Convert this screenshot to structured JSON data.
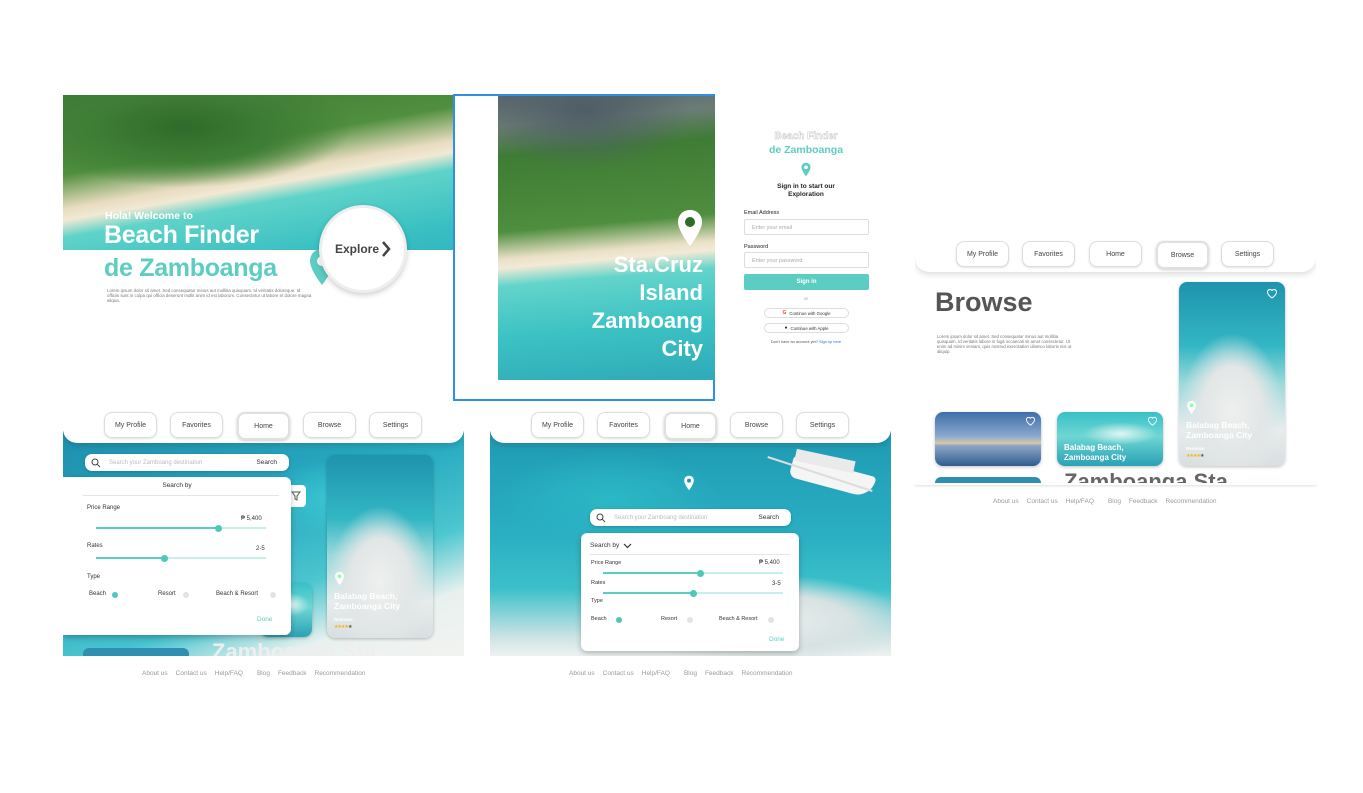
{
  "welcome": {
    "greeting": "Hola! Welcome to",
    "title_line1": "Beach Finder",
    "title_line2": "de Zamboanga",
    "explore": "Explore",
    "lorem": "Lorem ipsum dolor sit amet. Sed consequatur minus aut mollitia quisquam. Id veritatis doloreque. Id officiis sunt in culpa qui officia deserunt mollit anim id est laborum. Consectetur ut labore et dolore magna aliqua."
  },
  "splash": {
    "line1": "Sta.Cruz",
    "line2": "Island",
    "line3": "Zamboang",
    "line4": "City"
  },
  "signin": {
    "brand_line1": "Beach Finder",
    "brand_line2": "de Zamboanga",
    "heading": "Sign in to start our Exploration",
    "email_label": "Email Address",
    "email_placeholder": "Enter your email",
    "password_label": "Password",
    "password_placeholder": "Enter your password",
    "signin_button": "Sign in",
    "or": "or",
    "google": "Continue with Google",
    "apple": "Continue with Apple",
    "no_account": "Don't have an account yet?",
    "signup": "Sign up here"
  },
  "nav": {
    "my_profile": "My Profile",
    "favorites": "Favorites",
    "home": "Home",
    "browse": "Browse",
    "settings": "Settings"
  },
  "browse": {
    "title": "Browse",
    "lorem": "Lorem ipsum dolor sit amet. Sed consequatur minus aut mollitia quisquam. Id veritatis labore in fugit occaecati sit amet consectetur. Ut enim ad minim veniam, quis nostrud exercitation ullamco laboris nisi ut aliquip.",
    "feature_name": "Balabag Beach, Zamboanga City",
    "reviews": "Reviews:",
    "card2": "Balabag Beach, Zamboanga City",
    "bottom_title": "Zamboanga Sta"
  },
  "search": {
    "placeholder1": "Search your Zamboang destination",
    "placeholder2": "Search your Zamboang destination",
    "button": "Search",
    "search_by": "Search by",
    "price_range": "Price Range",
    "price_value": "₱ 5,400",
    "rates": "Rates",
    "rates_value1": "2-5",
    "rates_value2": "3-5",
    "type": "Type",
    "beach": "Beach",
    "resort": "Resort",
    "beach_resort": "Beach & Resort",
    "done": "Done",
    "price_fraction": 0.72,
    "rates_fraction1": 0.4,
    "rates_fraction2": 0.5
  },
  "home": {
    "card_name": "Balabag Beach, Zamboanga City",
    "reviews": "Reviews:",
    "bottom_title": "Zamboanga Sta"
  },
  "footer": {
    "about": "About us",
    "contact": "Contact us",
    "help": "Help/FAQ",
    "blog": "Blog",
    "feedback": "Feedback",
    "recommendation": "Recommendation"
  },
  "colors": {
    "teal": "#5ccdc2",
    "selection": "#2d8fe6",
    "star": "#f2b51b"
  }
}
